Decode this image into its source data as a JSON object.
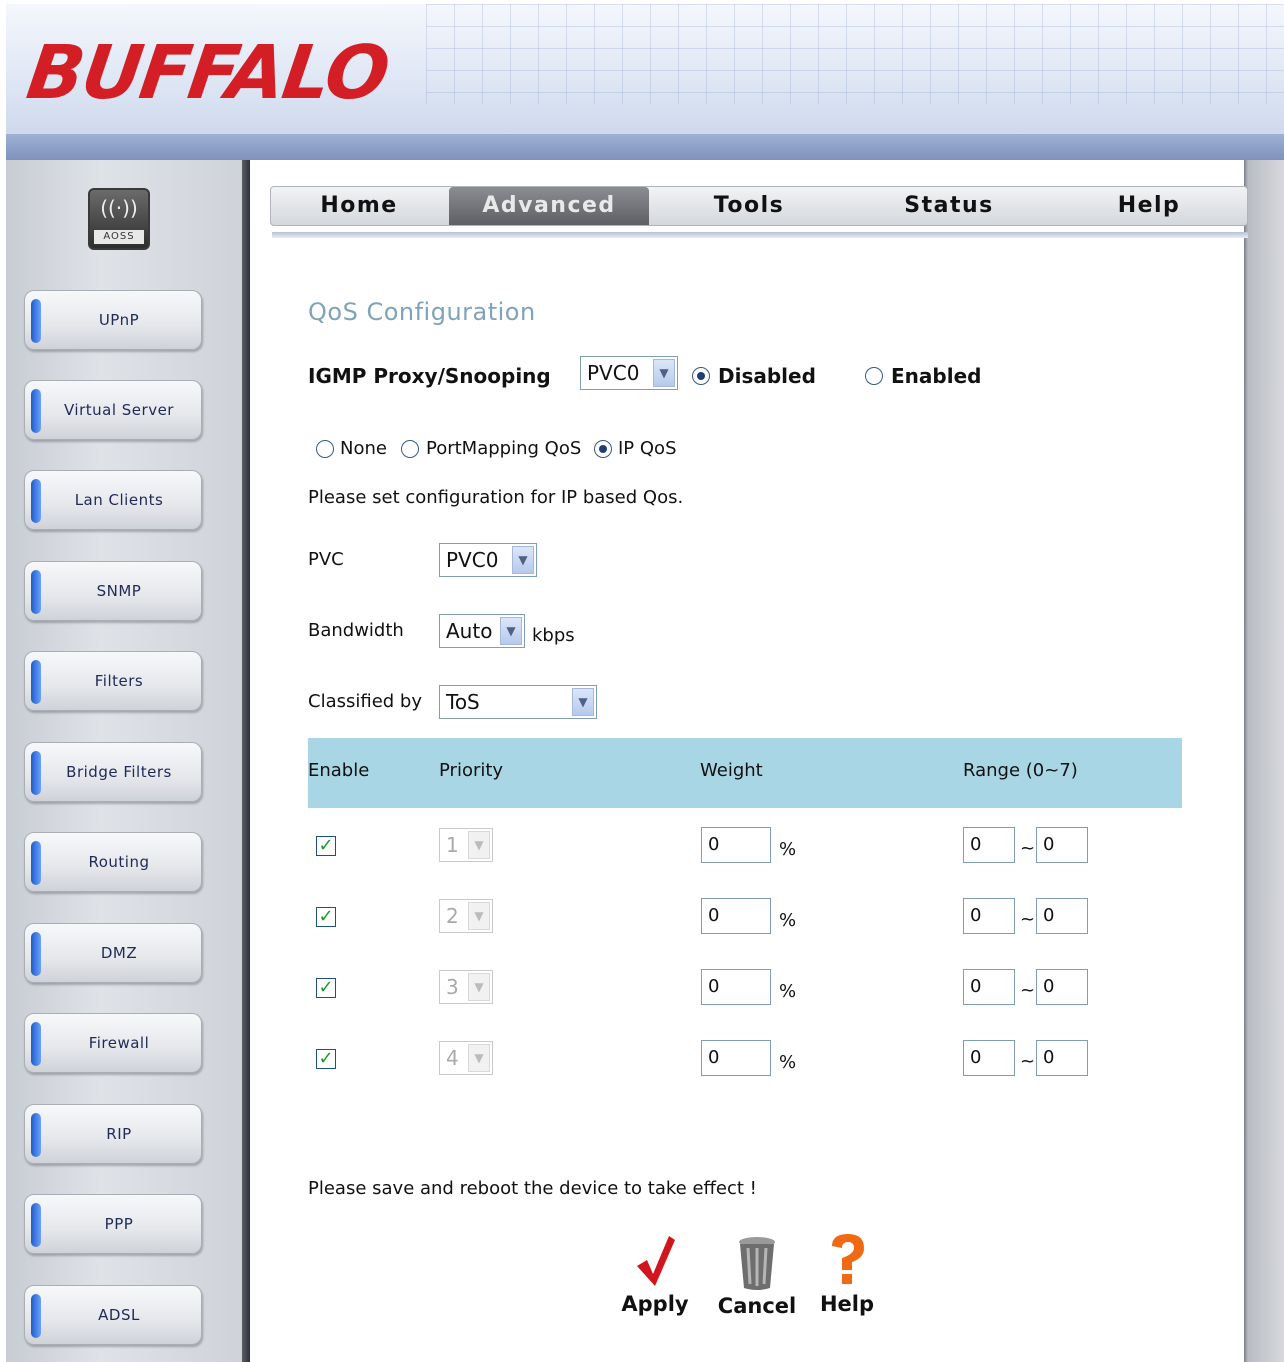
{
  "brand": {
    "logo_text": "BUFFALO",
    "accent": "#d41e26"
  },
  "aoss": {
    "label": "AOSS",
    "icon": "wireless-waves-icon"
  },
  "sidebar": {
    "items": [
      {
        "label": "UPnP"
      },
      {
        "label": "Virtual Server"
      },
      {
        "label": "Lan Clients"
      },
      {
        "label": "SNMP"
      },
      {
        "label": "Filters"
      },
      {
        "label": "Bridge Filters"
      },
      {
        "label": "Routing"
      },
      {
        "label": "DMZ"
      },
      {
        "label": "Firewall"
      },
      {
        "label": "RIP"
      },
      {
        "label": "PPP"
      },
      {
        "label": "ADSL"
      }
    ]
  },
  "tabs": [
    {
      "label": "Home",
      "active": false
    },
    {
      "label": "Advanced",
      "active": true
    },
    {
      "label": "Tools",
      "active": false
    },
    {
      "label": "Status",
      "active": false
    },
    {
      "label": "Help",
      "active": false
    }
  ],
  "page": {
    "title": "QoS Configuration",
    "igmp": {
      "label": "IGMP Proxy/Snooping",
      "pvc_value": "PVC0",
      "disabled_label": "Disabled",
      "enabled_label": "Enabled",
      "selected": "Disabled"
    },
    "qos_mode": {
      "none_label": "None",
      "portmapping_label": "PortMapping QoS",
      "ip_label": "IP QoS",
      "selected": "IP QoS"
    },
    "instruction": "Please set configuration for IP based Qos.",
    "pvc": {
      "label": "PVC",
      "value": "PVC0"
    },
    "bandwidth": {
      "label": "Bandwidth",
      "value": "Auto",
      "unit": "kbps"
    },
    "classified": {
      "label": "Classified by",
      "value": "ToS"
    },
    "table": {
      "headers": {
        "enable": "Enable",
        "priority": "Priority",
        "weight": "Weight",
        "range": "Range (0~7)"
      },
      "percent": "%",
      "tilde": "~",
      "rows": [
        {
          "enabled": true,
          "priority": "1",
          "weight": "0",
          "range_from": "0",
          "range_to": "0"
        },
        {
          "enabled": true,
          "priority": "2",
          "weight": "0",
          "range_from": "0",
          "range_to": "0"
        },
        {
          "enabled": true,
          "priority": "3",
          "weight": "0",
          "range_from": "0",
          "range_to": "0"
        },
        {
          "enabled": true,
          "priority": "4",
          "weight": "0",
          "range_from": "0",
          "range_to": "0"
        }
      ]
    },
    "note": "Please save and reboot the device to take effect !",
    "actions": {
      "apply": {
        "label": "Apply",
        "icon": "checkmark-icon",
        "color": "#d0161c"
      },
      "cancel": {
        "label": "Cancel",
        "icon": "trash-can-icon"
      },
      "help": {
        "label": "Help",
        "icon": "question-mark-icon",
        "color": "#f06a14"
      }
    },
    "header_bg": "#a9d6e5",
    "title_color": "#7fa3b8"
  }
}
